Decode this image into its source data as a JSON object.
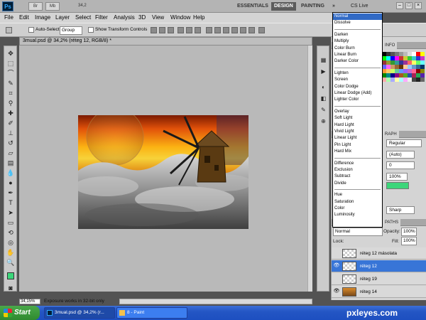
{
  "app": {
    "logo": "Ps",
    "app_icons": [
      "Br",
      "Mb"
    ],
    "zoom_select": "34,2",
    "workspaces": [
      "ESSENTIALS",
      "DESIGN",
      "PAINTING"
    ],
    "more": "»",
    "cs_live": "CS Live",
    "window_controls": [
      "–",
      "□",
      "×"
    ]
  },
  "menu": [
    "File",
    "Edit",
    "Image",
    "Layer",
    "Select",
    "Filter",
    "Analysis",
    "3D",
    "View",
    "Window",
    "Help"
  ],
  "options": {
    "auto_select_label": "Auto-Select:",
    "auto_select_value": "Group",
    "show_transform_label": "Show Transform Controls"
  },
  "document": {
    "tab_title": "3mual.psd @ 34,2% (réteg 12, RGB/8) *",
    "zoom": "34,15%",
    "status": "Exposure works in 32-bit only"
  },
  "panels": {
    "info_tab": "INFO",
    "character_tab": "RAPH",
    "paths_tab": "PATHS",
    "font_style": "Regular",
    "leading": "(Auto)",
    "tracking": "0",
    "scale": "100%",
    "antialias": "Sharp",
    "accent_color": "#3cd67a"
  },
  "layers": {
    "blend_mode": "Normal",
    "opacity_label": "Opacity:",
    "opacity_value": "100%",
    "lock_label": "Lock:",
    "fill_label": "Fill:",
    "fill_value": "100%",
    "items": [
      {
        "name": "réteg 12 másolata",
        "visible": false,
        "selected": false
      },
      {
        "name": "réteg 12",
        "visible": true,
        "selected": true
      },
      {
        "name": "réteg 19",
        "visible": false,
        "selected": false
      },
      {
        "name": "réteg 14",
        "visible": true,
        "selected": false
      }
    ]
  },
  "blend_modes": {
    "groups": [
      [
        "Normal",
        "Dissolve"
      ],
      [
        "Darken",
        "Multiply",
        "Color Burn",
        "Linear Burn",
        "Darker Color"
      ],
      [
        "Lighten",
        "Screen",
        "Color Dodge",
        "Linear Dodge (Add)",
        "Lighter Color"
      ],
      [
        "Overlay",
        "Soft Light",
        "Hard Light",
        "Vivid Light",
        "Linear Light",
        "Pin Light",
        "Hard Mix"
      ],
      [
        "Difference",
        "Exclusion",
        "Subtract",
        "Divide"
      ],
      [
        "Hue",
        "Saturation",
        "Color",
        "Luminosity"
      ]
    ],
    "highlighted": "Normal"
  },
  "taskbar": {
    "start": "Start",
    "tasks": [
      "3mual.psd @ 34,2% (r...",
      "8 - Paint"
    ],
    "watermark": "pxleyes.com"
  },
  "colors": {
    "foreground": "#3cd67a",
    "background": "#ffffff",
    "selection": "#3875d7"
  }
}
